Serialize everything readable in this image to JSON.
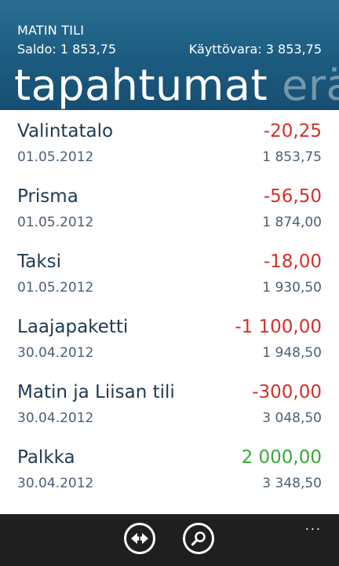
{
  "header": {
    "account_name": "MATIN TILI",
    "saldo_label": "Saldo: 1 853,75",
    "available_label": "Käyttövara: 3 853,75",
    "pivot_active": "tapahtumat",
    "pivot_next": "erä"
  },
  "transactions": [
    {
      "name": "Valintatalo",
      "date": "01.05.2012",
      "amount": "-20,25",
      "balance": "1 853,75",
      "type": "debit"
    },
    {
      "name": "Prisma",
      "date": "01.05.2012",
      "amount": "-56,50",
      "balance": "1 874,00",
      "type": "debit"
    },
    {
      "name": "Taksi",
      "date": "01.05.2012",
      "amount": "-18,00",
      "balance": "1 930,50",
      "type": "debit"
    },
    {
      "name": "Laajapaketti",
      "date": "30.04.2012",
      "amount": "-1 100,00",
      "balance": "1 948,50",
      "type": "debit"
    },
    {
      "name": "Matin ja Liisan tili",
      "date": "30.04.2012",
      "amount": "-300,00",
      "balance": "3 048,50",
      "type": "debit"
    },
    {
      "name": "Palkka",
      "date": "30.04.2012",
      "amount": "2 000,00",
      "balance": "3 348,50",
      "type": "credit"
    }
  ],
  "appbar": {
    "buttons": [
      {
        "icon": "transfer-icon"
      },
      {
        "icon": "search-icon"
      }
    ],
    "more_label": "..."
  },
  "colors": {
    "header_bg": "#1c5b80",
    "debit": "#d3312b",
    "credit": "#3aa83a",
    "appbar_bg": "#1f1f1f"
  }
}
